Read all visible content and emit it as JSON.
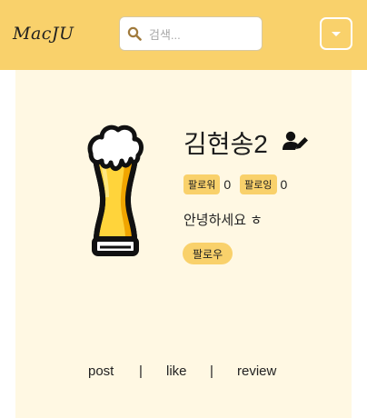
{
  "navbar": {
    "brand": "MacJU",
    "search_placeholder": "검색...",
    "search_value": "",
    "icons": {
      "search": "search-icon",
      "menu": "caret-down-icon"
    }
  },
  "profile": {
    "avatar_icon": "beer-glass-icon",
    "username": "김현송2",
    "edit_icon": "user-edit-icon",
    "followers_label": "팔로워",
    "followers_count": "0",
    "following_label": "팔로잉",
    "following_count": "0",
    "bio": "안녕하세요 ㅎ",
    "follow_button": "팔로우"
  },
  "tabs": {
    "post": "post",
    "sep1": "|",
    "like": "like",
    "sep2": "|",
    "review": "review"
  },
  "colors": {
    "navbar": "#f9d16b",
    "content_bg": "#fff8e3",
    "badge": "#f9d16b",
    "beer": "#ffd43b",
    "beer_shade": "#f0a500"
  }
}
